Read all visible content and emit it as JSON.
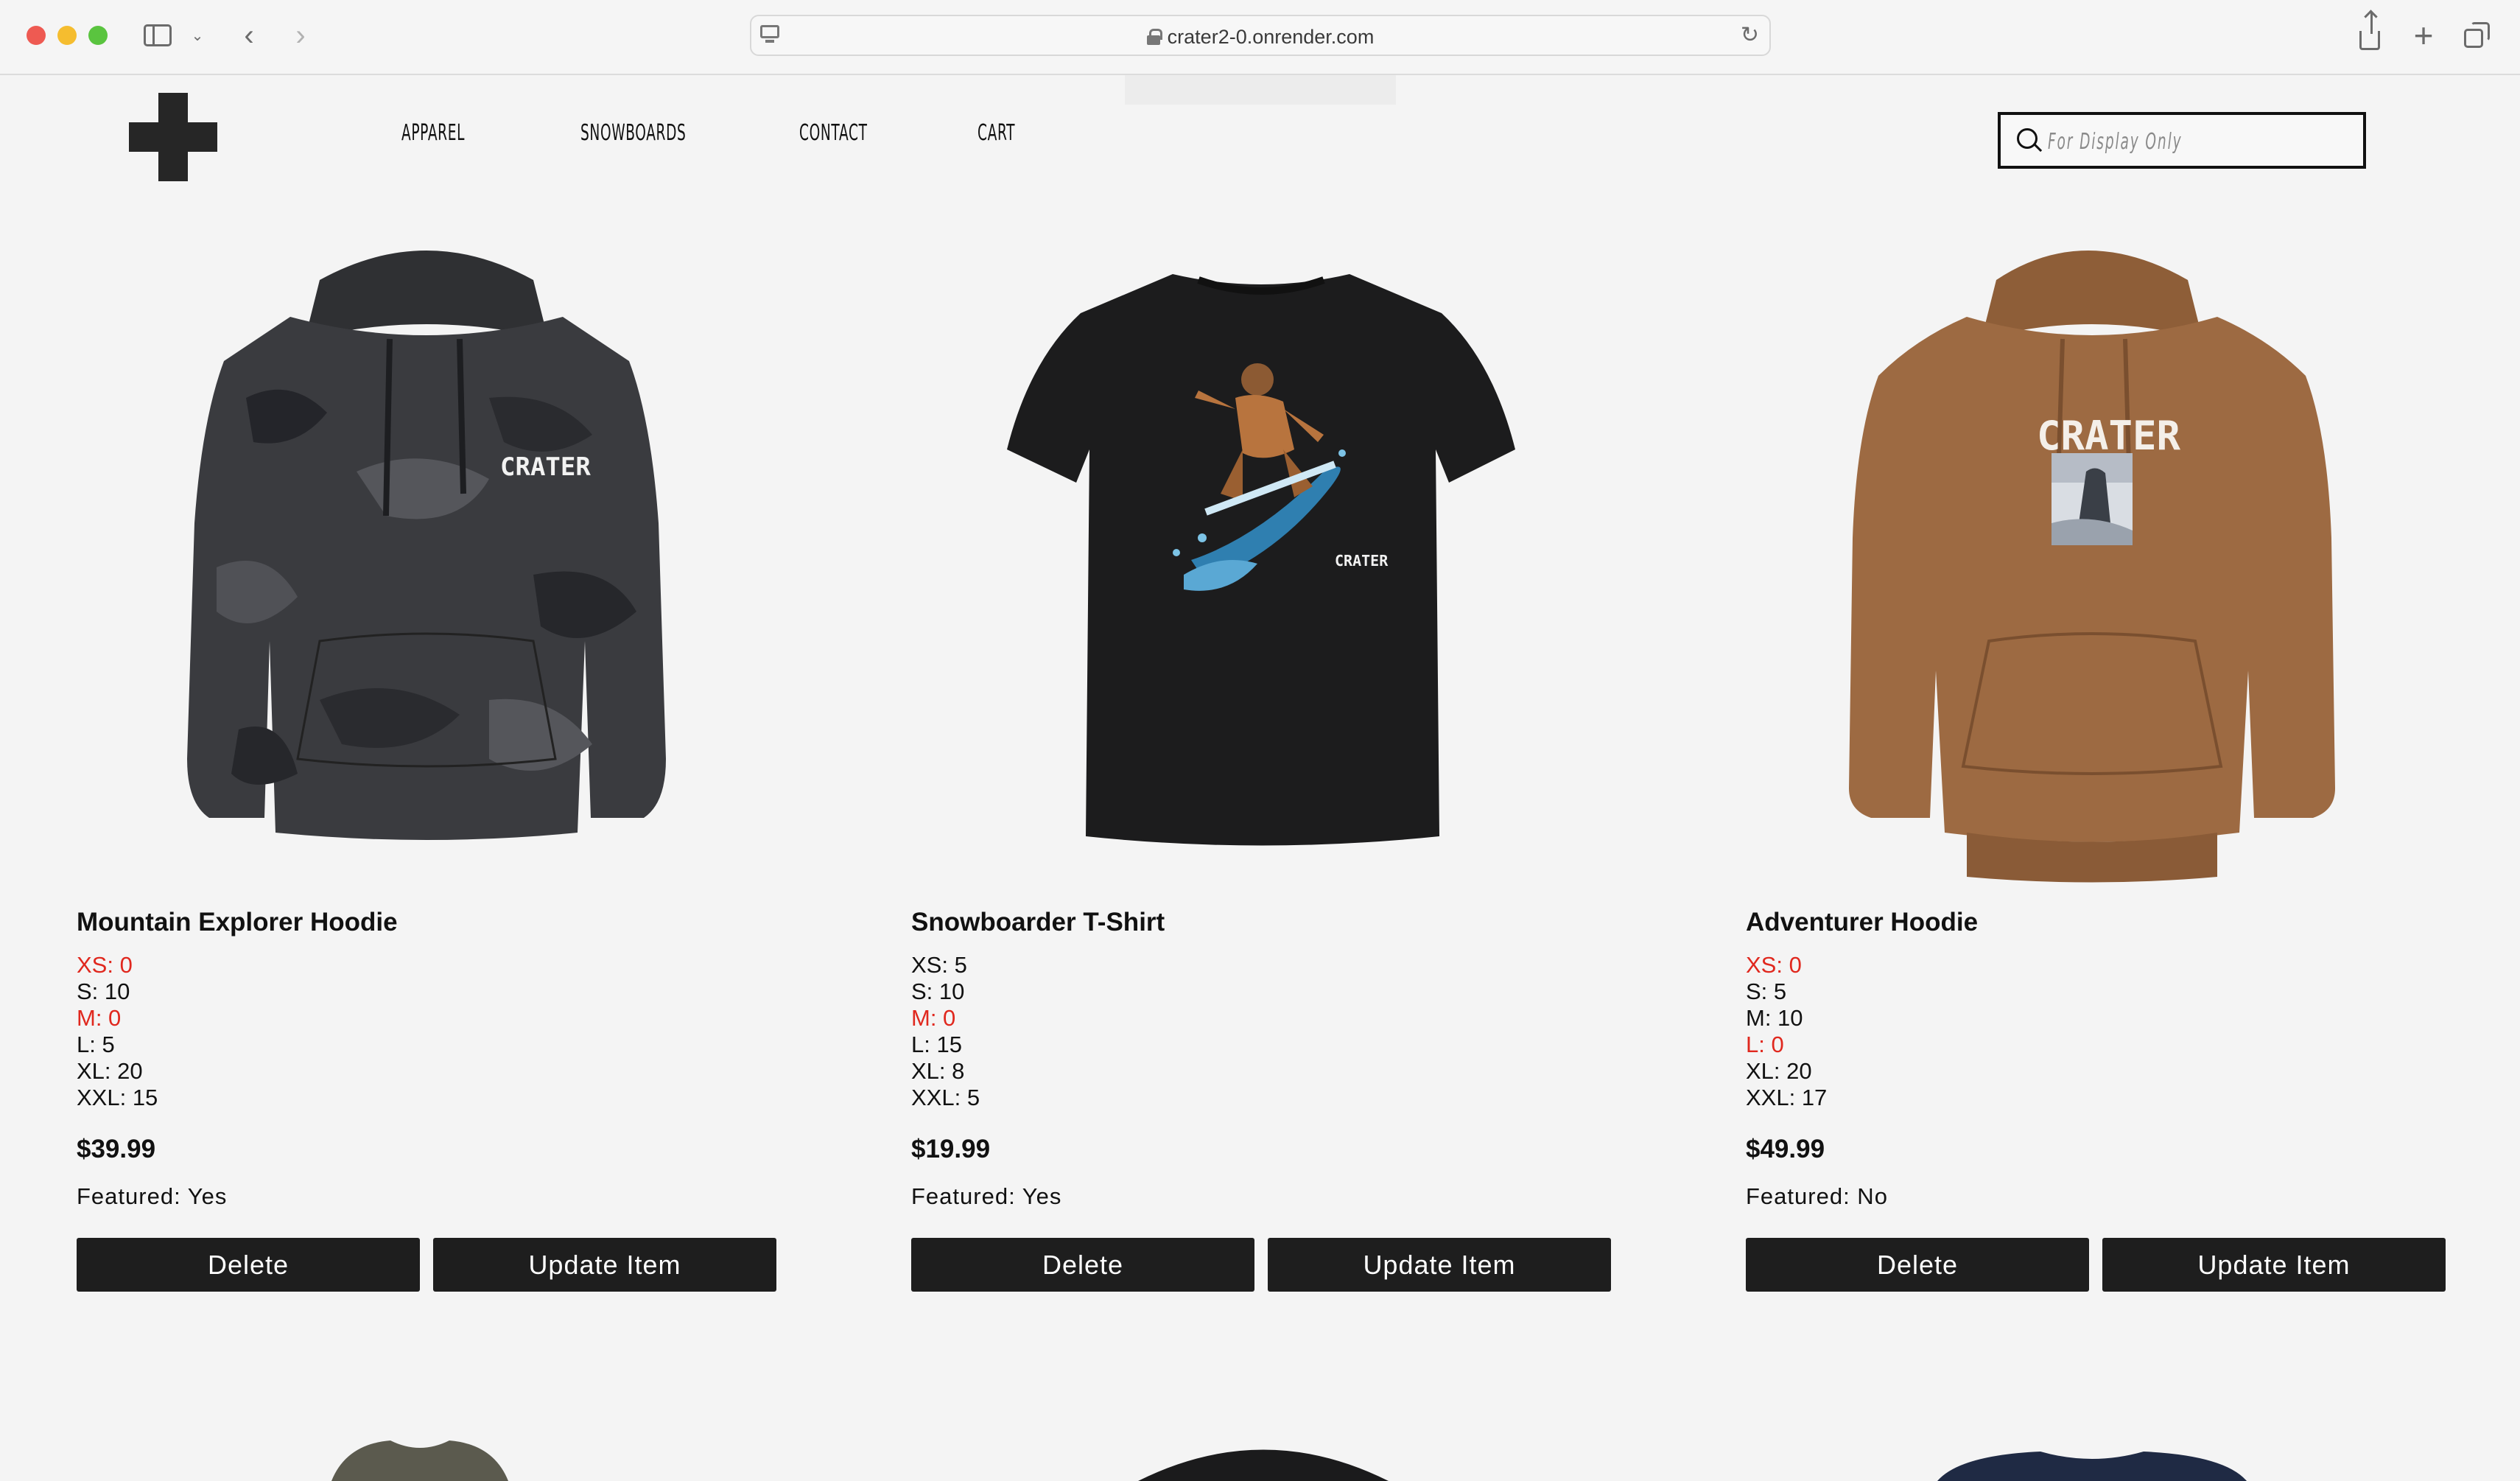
{
  "browser": {
    "url": "crater2-0.onrender.com"
  },
  "nav": {
    "items": [
      "APPAREL",
      "SNOWBOARDS",
      "CONTACT",
      "CART"
    ]
  },
  "search": {
    "placeholder": "For Display Only"
  },
  "colors": {
    "out_of_stock": "#e0281e",
    "button_bg": "#1e1e1e",
    "page_bg": "#f4f4f4"
  },
  "products": [
    {
      "title": "Mountain Explorer Hoodie",
      "image_icon": "camo-hoodie-image",
      "stock": [
        {
          "text": "XS: 0",
          "out": true
        },
        {
          "text": "S: 10",
          "out": false
        },
        {
          "text": "M: 0",
          "out": true
        },
        {
          "text": "L: 5",
          "out": false
        },
        {
          "text": "XL: 20",
          "out": false
        },
        {
          "text": "XXL: 15",
          "out": false
        }
      ],
      "price": "$39.99",
      "featured": "Featured: Yes",
      "delete_label": "Delete",
      "update_label": "Update Item"
    },
    {
      "title": "Snowboarder T-Shirt",
      "image_icon": "black-tshirt-image",
      "stock": [
        {
          "text": "XS: 5",
          "out": false
        },
        {
          "text": "S: 10",
          "out": false
        },
        {
          "text": "M: 0",
          "out": true
        },
        {
          "text": "L: 15",
          "out": false
        },
        {
          "text": "XL: 8",
          "out": false
        },
        {
          "text": "XXL: 5",
          "out": false
        }
      ],
      "price": "$19.99",
      "featured": "Featured: Yes",
      "delete_label": "Delete",
      "update_label": "Update Item"
    },
    {
      "title": "Adventurer Hoodie",
      "image_icon": "brown-hoodie-image",
      "stock": [
        {
          "text": "XS: 0",
          "out": true
        },
        {
          "text": "S: 5",
          "out": false
        },
        {
          "text": "M: 10",
          "out": false
        },
        {
          "text": "L: 0",
          "out": true
        },
        {
          "text": "XL: 20",
          "out": false
        },
        {
          "text": "XXL: 17",
          "out": false
        }
      ],
      "price": "$49.99",
      "featured": "Featured: No",
      "delete_label": "Delete",
      "update_label": "Update Item"
    }
  ]
}
